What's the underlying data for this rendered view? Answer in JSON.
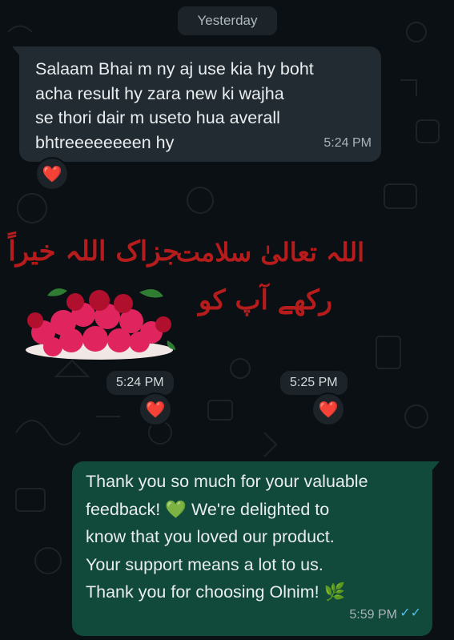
{
  "date_chip": "Yesterday",
  "incoming_message": {
    "lines": [
      "Salaam Bhai m ny aj use kia hy boht",
      "acha result hy zara new ki wajha",
      "se thori dair m useto hua averall",
      "bhtreeeeeeeen hy"
    ],
    "time": "5:24 PM",
    "reaction": "❤️"
  },
  "sticker_one": {
    "text": "جزاک اللہ خیراً",
    "time": "5:24 PM",
    "reaction": "❤️"
  },
  "sticker_two": {
    "line1": "اللہ تعالیٰ سلامت",
    "line2": "رکھے آپ کو",
    "time": "5:25 PM",
    "reaction": "❤️"
  },
  "outgoing_message": {
    "line1": "Thank you so much for your valuable",
    "line2_a": "feedback! ",
    "line2_emoji": "💚",
    "line2_b": " We're delighted to",
    "line3": "know that you loved our product.",
    "line4": "Your support means a lot to us.",
    "line5_a": "Thank you for choosing Olnim! ",
    "line5_emoji": "🌿",
    "time": "5:59 PM",
    "status": "✓✓"
  },
  "colors": {
    "background": "#0b1014",
    "incoming_bubble": "#222b31",
    "outgoing_bubble": "#11493b",
    "read_ticks": "#53bdeb",
    "reaction_heart": "#e0245e"
  }
}
